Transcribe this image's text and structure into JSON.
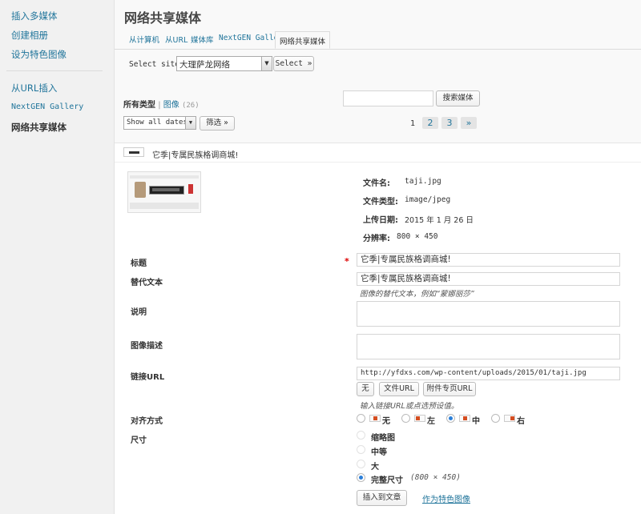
{
  "sidebar": {
    "items": [
      {
        "label": "插入多媒体"
      },
      {
        "label": "创建相册"
      },
      {
        "label": "设为特色图像"
      },
      {
        "label": "从URL插入"
      },
      {
        "label": "NextGEN Gallery"
      },
      {
        "label": "网络共享媒体"
      }
    ]
  },
  "header": {
    "title": "网络共享媒体"
  },
  "tabs": [
    {
      "label": "从计算机"
    },
    {
      "label": "从URL"
    },
    {
      "label": "媒体库"
    },
    {
      "label": "NextGEN Gallery"
    },
    {
      "label": "网络共享媒体"
    }
  ],
  "site_select": {
    "label": "Select site:",
    "value": "大理萨龙网络",
    "button": "Select »"
  },
  "filters": {
    "all_types": "所有类型",
    "separator": "|",
    "images": "图像",
    "image_count": "(26)",
    "search_button": "搜索媒体",
    "date_select": "Show all dates",
    "filter_button": "筛选 »"
  },
  "pagination": {
    "current": "1",
    "pages": [
      "2",
      "3"
    ],
    "next": "»"
  },
  "item": {
    "title": "它季|专属民族格调商城!",
    "file_name_label": "文件名:",
    "file_name": "taji.jpg",
    "file_type_label": "文件类型:",
    "file_type": "image/jpeg",
    "upload_date_label": "上传日期:",
    "upload_date": "2015 年 1 月 26 日",
    "resolution_label": "分辨率:",
    "resolution": "800 × 450"
  },
  "form": {
    "title_label": "标题",
    "required_mark": "*",
    "title_value": "它季|专属民族格调商城!",
    "alt_label": "替代文本",
    "alt_value": "它季|专属民族格调商城!",
    "alt_hint": "图像的替代文本，例如“蒙娜丽莎”",
    "caption_label": "说明",
    "description_label": "图像描述",
    "link_label": "链接URL",
    "link_value": "http://yfdxs.com/wp-content/uploads/2015/01/taji.jpg",
    "link_none": "无",
    "link_file": "文件URL",
    "link_attachment": "附件专页URL",
    "link_hint": "输入链接URL或点选预设值。",
    "align_label": "对齐方式",
    "align_options": [
      {
        "label": "无",
        "selected": false
      },
      {
        "label": "左",
        "selected": false
      },
      {
        "label": "中",
        "selected": true
      },
      {
        "label": "右",
        "selected": false
      }
    ],
    "size_label": "尺寸",
    "size_options": [
      {
        "label": "缩略图",
        "selected": false
      },
      {
        "label": "中等",
        "selected": false
      },
      {
        "label": "大",
        "selected": false
      },
      {
        "label": "完整尺寸",
        "selected": true,
        "dims": "(800 × 450)"
      }
    ],
    "insert_button": "插入到文章",
    "featured_link": "作为特色图像"
  }
}
